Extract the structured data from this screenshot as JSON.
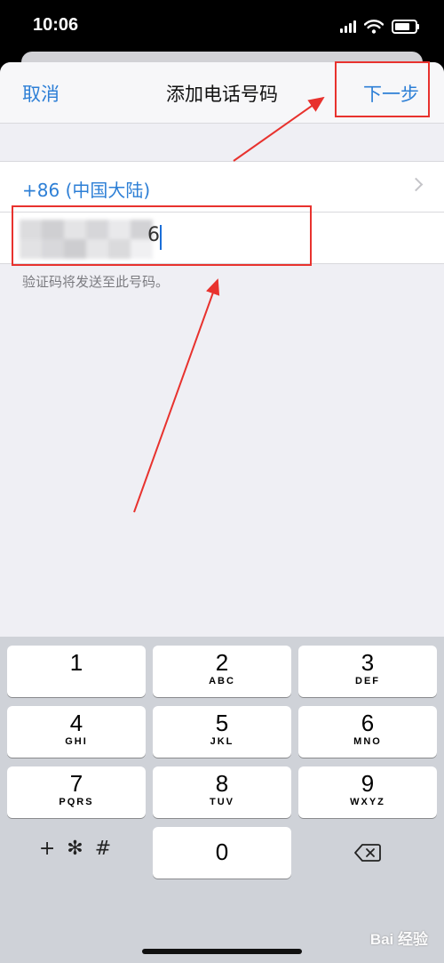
{
  "status_bar": {
    "time": "10:06"
  },
  "nav": {
    "cancel": "取消",
    "title": "添加电话号码",
    "next": "下一步"
  },
  "form": {
    "country": "+86 (中国大陆)",
    "phone_value": "",
    "phone_visible_tail": "6",
    "hint": "验证码将发送至此号码。"
  },
  "keypad": {
    "keys": [
      {
        "digit": "1",
        "letters": ""
      },
      {
        "digit": "2",
        "letters": "ABC"
      },
      {
        "digit": "3",
        "letters": "DEF"
      },
      {
        "digit": "4",
        "letters": "GHI"
      },
      {
        "digit": "5",
        "letters": "JKL"
      },
      {
        "digit": "6",
        "letters": "MNO"
      },
      {
        "digit": "7",
        "letters": "PQRS"
      },
      {
        "digit": "8",
        "letters": "TUV"
      },
      {
        "digit": "9",
        "letters": "WXYZ"
      }
    ],
    "symbols": "+ ✻ #",
    "zero": "0"
  },
  "watermark": "Bai 经验",
  "colors": {
    "accent": "#2d7fd6",
    "annotation": "#e8322e"
  }
}
